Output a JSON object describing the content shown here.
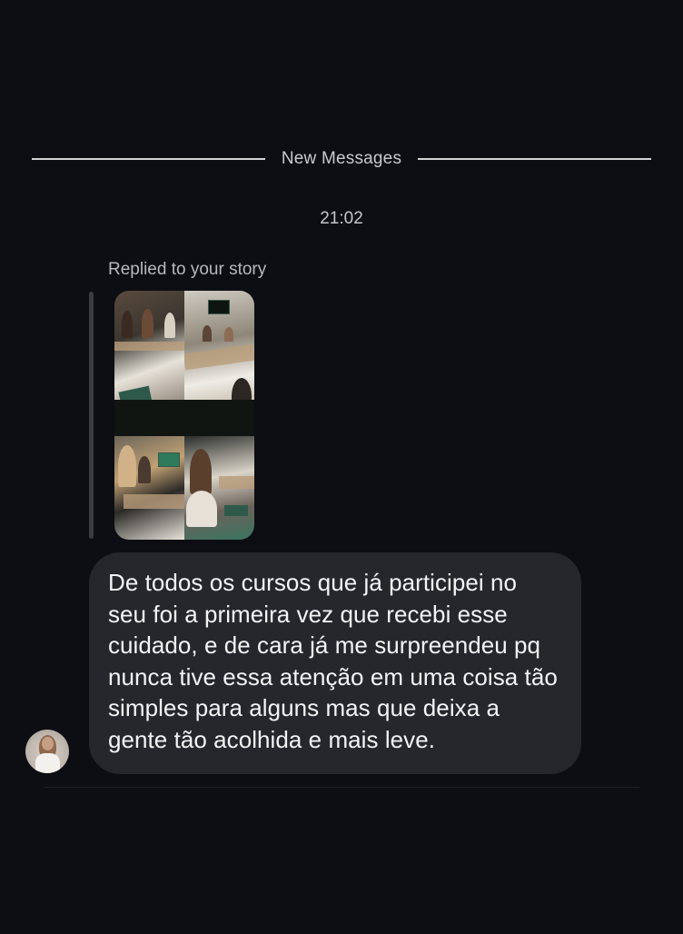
{
  "conversation": {
    "divider_label": "New Messages",
    "timestamp": "21:02",
    "story_reply": {
      "label": "Replied to your story",
      "thumbnail_icon": "story-collage-image"
    },
    "message": {
      "text": "De todos os cursos que já participei no seu foi a primeira vez que recebi esse cuidado, e de cara já me surpreendeu pq nunca tive essa atenção em uma coisa tão simples para alguns mas que deixa a gente tão acolhida e mais leve.",
      "sender_avatar_icon": "user-avatar-icon"
    }
  },
  "colors": {
    "background": "#0c0e13",
    "bubble": "#25272d",
    "divider_line": "#e9e9ec",
    "secondary_text": "#c6c7cd",
    "reply_bar": "#3a3c43"
  }
}
